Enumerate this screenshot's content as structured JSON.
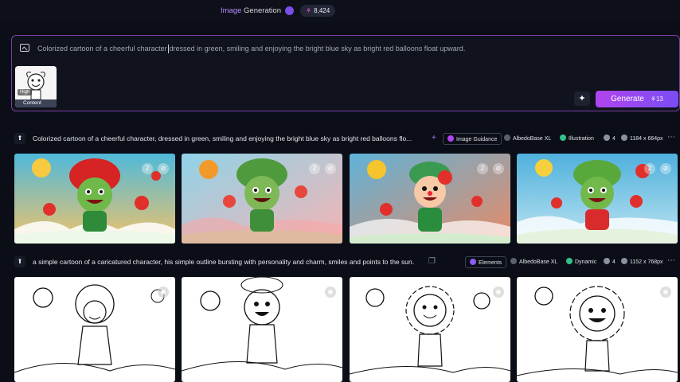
{
  "topbar": {
    "title_prefix": "Image",
    "title_suffix": " Generation",
    "token_badge": "8,424",
    "token_icon": "token-icon"
  },
  "prompt": {
    "text_before_cursor": "Colorized cartoon of a cheerful character",
    "text_after_cursor": "dressed in green, smiling and enjoying the bright blue sky as bright red balloons float upward.",
    "image_guidance": {
      "badge": "High",
      "label": "Content"
    },
    "generate_button": {
      "label": "Generate",
      "cost": "13"
    }
  },
  "generations": [
    {
      "prompt": "Colorized cartoon of a cheerful character, dressed in green, smiling and enjoying the bright blue sky as bright red balloons flo...",
      "chips": [
        {
          "label": "Image Guidance",
          "icon": "image-guidance-icon"
        },
        {
          "label": "AlbedoBase XL",
          "icon": "model-icon"
        },
        {
          "label": "Illustration",
          "icon": "brush-icon"
        },
        {
          "label": "4",
          "icon": "images-icon"
        },
        {
          "label": "1184 x 664px",
          "icon": "dimensions-icon"
        }
      ],
      "images": [
        "colored-character-1",
        "colored-character-2",
        "colored-character-3",
        "colored-character-4"
      ]
    },
    {
      "prompt": "a simple cartoon of a caricatured character, his simple outline bursting with personality and charm, smiles and points to the sun.",
      "chips": [
        {
          "label": "Elements",
          "icon": "elements-icon"
        },
        {
          "label": "AlbedoBase XL",
          "icon": "model-icon"
        },
        {
          "label": "Dynamic",
          "icon": "brush-icon"
        },
        {
          "label": "4",
          "icon": "images-icon"
        },
        {
          "label": "1152 x 768px",
          "icon": "dimensions-icon"
        }
      ],
      "images": [
        "lineart-character-1",
        "lineart-character-2",
        "lineart-character-3",
        "lineart-character-4"
      ]
    }
  ],
  "colors": {
    "accent": "#b044f0",
    "background": "#0b0e17"
  }
}
